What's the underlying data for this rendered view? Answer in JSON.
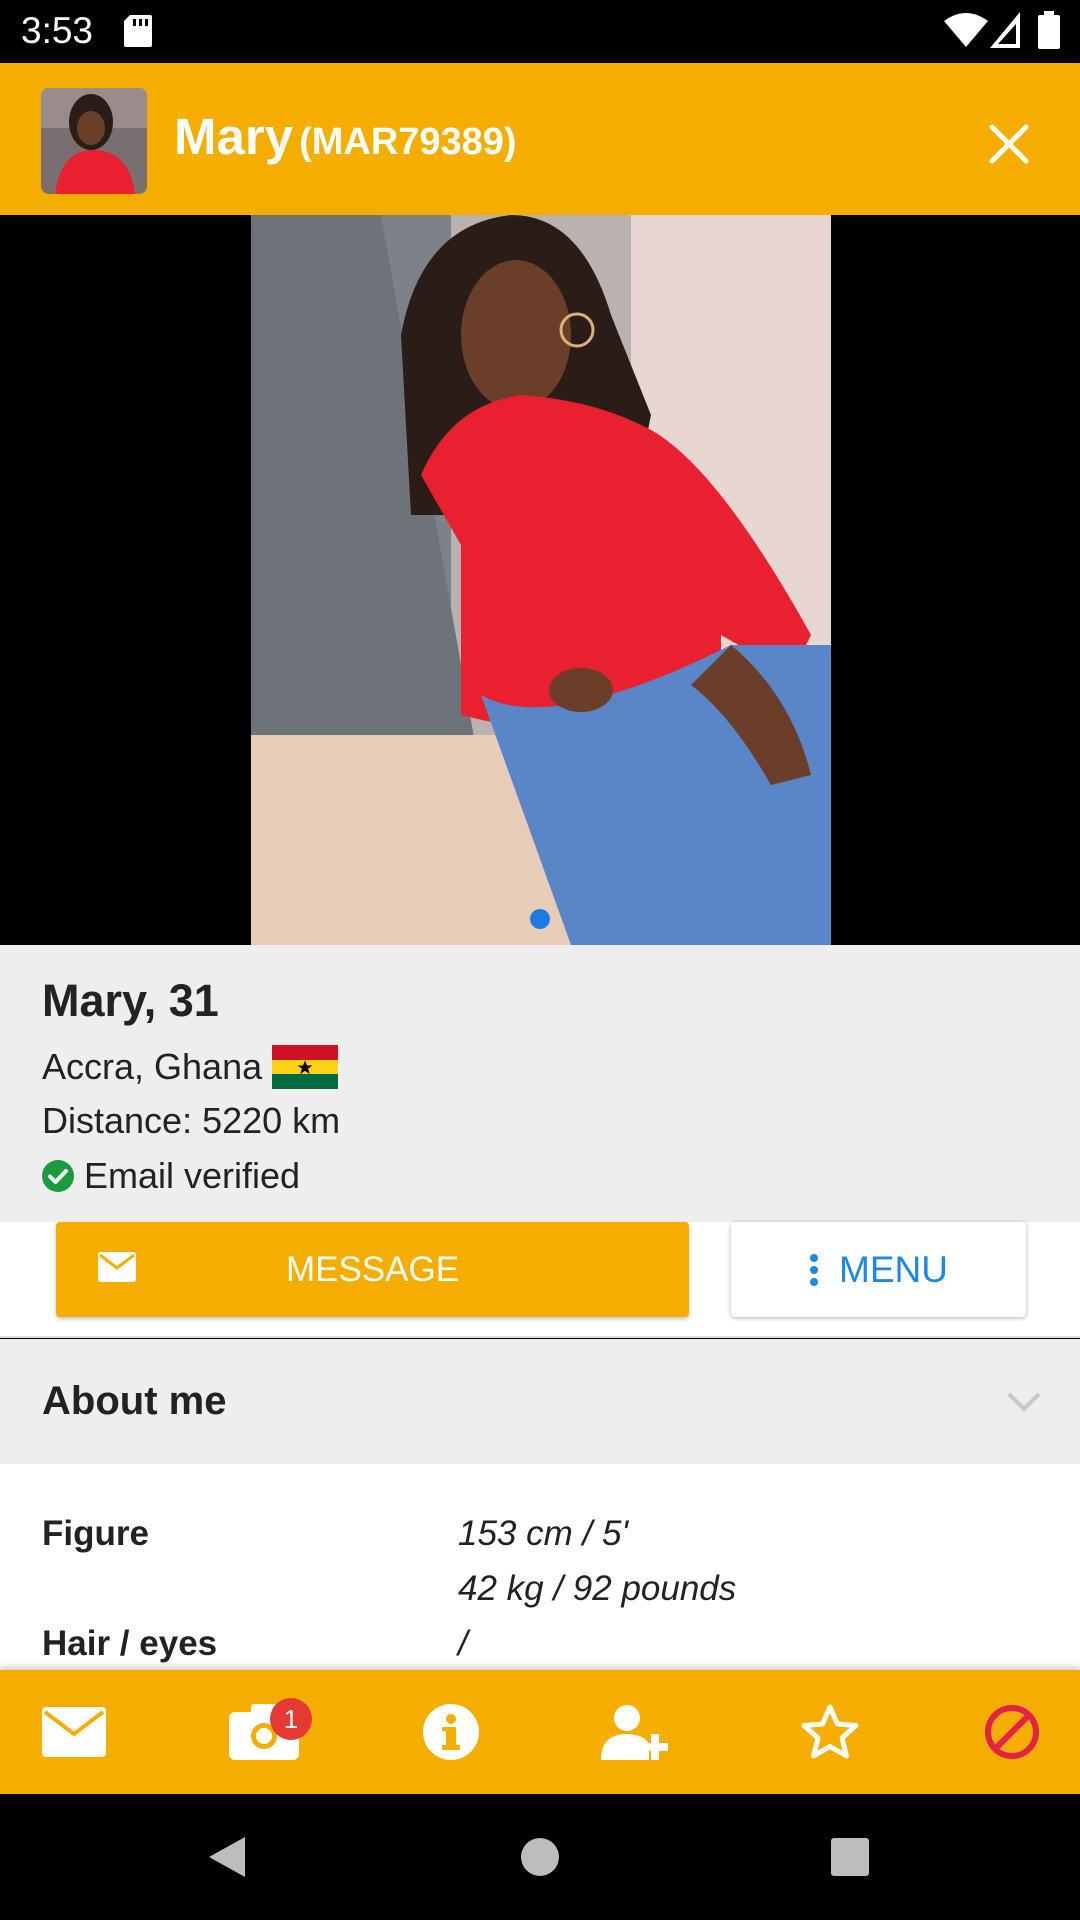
{
  "status_bar": {
    "time": "3:53",
    "icons": [
      "sd-card-icon",
      "wifi-icon",
      "signal-icon",
      "battery-icon"
    ]
  },
  "header": {
    "name": "Mary",
    "id": "(MAR79389)",
    "close_icon": "close-icon"
  },
  "photo": {
    "dots": 1,
    "active_dot": 1,
    "description_icon": "profile-photo"
  },
  "profile": {
    "title": "Mary, 31",
    "location": "Accra, Ghana",
    "distance": "Distance: 5220 km",
    "verified": "Email verified"
  },
  "actions": {
    "message": "MESSAGE",
    "menu": "MENU"
  },
  "about": {
    "title": "About me",
    "rows": [
      {
        "label": "Figure",
        "values": [
          "153 cm / 5'",
          "42 kg / 92 pounds"
        ]
      },
      {
        "label": "Hair / eyes",
        "values": [
          "/"
        ]
      }
    ]
  },
  "bottom_nav": {
    "items": [
      "mail-icon",
      "camera-icon",
      "info-icon",
      "add-user-icon",
      "star-icon",
      "block-icon"
    ],
    "photo_badge": "1"
  },
  "system_nav": [
    "back-icon",
    "home-icon",
    "recents-icon"
  ],
  "colors": {
    "accent": "#F5AD00",
    "link": "#1E88E5",
    "verified": "#1B9A3E",
    "block": "#E3224B",
    "badge": "#E53935"
  }
}
